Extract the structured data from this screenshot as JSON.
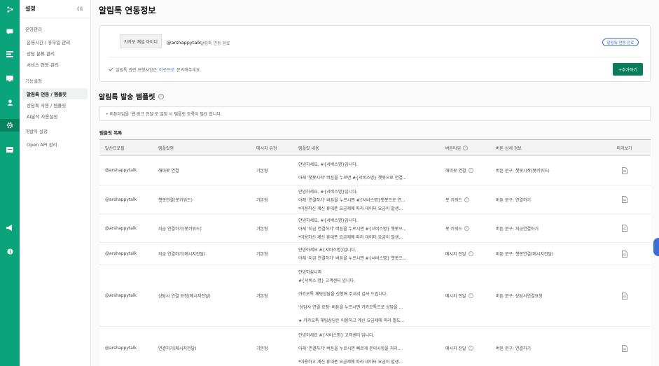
{
  "rail": {
    "icons": [
      "flow-icon",
      "chat-icon",
      "list-icon",
      "message-icon",
      "user-icon",
      "gear-icon",
      "card-icon",
      "megaphone-icon",
      "info-icon"
    ]
  },
  "sidebar": {
    "title": "설정",
    "groups": [
      {
        "label": "운영관리",
        "items": [
          "운영시간 / 휴무일 관리",
          "상담 분류 관리",
          "서비스 연동 관리"
        ]
      },
      {
        "label": "기능설정",
        "items": [
          "알림톡 연동 / 템플릿",
          "상담톡 사용 / 템플릿",
          "AI분석 사용설정"
        ]
      },
      {
        "label": "개발자 설정",
        "items": [
          "Open API 관리"
        ]
      }
    ]
  },
  "page": {
    "title": "알림톡 연동정보"
  },
  "channel": {
    "chip": "카카오 채널 아이디",
    "id": "@arshappytalk",
    "status": "알림톡 연동 완료",
    "pill": "알림톡 연동 완료",
    "notice_prefix": "알림톡 관련 요청사항은",
    "notice_link": "이곳으로",
    "notice_suffix": "문의해주세요.",
    "add_button": "+추가하기"
  },
  "templates": {
    "title": "알림톡 발송 템플릿",
    "help": "?",
    "info": "• 버튼타입을 '웹 링크 전달'로 설정 시 템플릿 등록이 필요 합니다.",
    "list_label": "템플릿 목록",
    "columns": [
      "발신프로필",
      "템플릿명",
      "메시지 유형",
      "템플릿 내용",
      "버튼타입",
      "버튼 상세 정보",
      "미리보기"
    ],
    "rows": [
      {
        "profile": "@arshappytalk",
        "name": "해피봇 연결",
        "type": "기본형",
        "content": [
          "안녕하세요. #{서비스명}입니다.",
          "",
          "아래 '챗봇시작' 버튼을 누르면 #{서비스명} 챗봇으로 연결..."
        ],
        "btn_type": "해피봇 연결",
        "btn_help": true,
        "btn_detail": "버튼 문구: 챗봇시작(봇키워드)"
      },
      {
        "profile": "@arshappytalk",
        "name": "챗봇연결(봇키워드)",
        "type": "기본형",
        "content": [
          "안녕하세요. #{서비스명}입니다.",
          "아래 '연결하기' 버튼을 누르시면 #{서비스명}챗봇으로 연...",
          "*이용하신 계신 휴대폰 요금제에 따라 데이터 요금이 발생..."
        ],
        "btn_type": "봇 키워드",
        "btn_help": true,
        "btn_detail": "버튼 문구: 연결하기"
      },
      {
        "profile": "@arshappytalk",
        "name": "지금 연결하기(봇키워드)",
        "type": "기본형",
        "content": [
          "안녕하세요. #{서비스명}입니다.",
          "아래 '지금 연결하기' 버튼을 누르시면 #{서비스명} 챗봇으...",
          "*이용하신 계신 휴대폰 요금제에 따라 데이터 요금이 발생..."
        ],
        "btn_type": "봇 키워드",
        "btn_help": true,
        "btn_detail": "버튼 문구: 지금연결하기"
      },
      {
        "profile": "@arshappytalk",
        "name": "지금 연결하기(메시지전달)",
        "type": "기본형",
        "content": [
          "안녕하세요 #{서비스명}입니다.",
          "아래 '지금 연결하기' 버튼을 누르시면 #{서비스명} 챗봇으..."
        ],
        "btn_type": "메시지 전달",
        "btn_help": true,
        "btn_detail": "버튼 문구: 챗봇연결(메시지전달)"
      },
      {
        "profile": "@arshappytalk",
        "name": "상담사 연결 요청(메시지전달)",
        "type": "기본형",
        "content": [
          "안녕하십니까",
          "#{서비스 명} 고객센터 입니다.",
          "",
          "카카오톡 채팅상담을 신청해 주셔서 감사 드립니다.",
          "",
          "'상담사 연결 요청' 버튼을 누르시면 카카오톡으로 상담을 ...",
          "",
          "★ 카카오톡 채팅상담은 이용하고 계신 요금제에 따라 별도..."
        ],
        "btn_type": "메시지 전달",
        "btn_help": true,
        "btn_detail": "버튼 문구: 상담사연결요청"
      },
      {
        "profile": "@arshappytalk",
        "name": "연결하기(메시지전달)",
        "type": "기본형",
        "content": [
          "안녕하세요 #{서비스명} 고객센터 입니다.",
          "",
          "아래 '연결하기' 버튼을 누르시면 빠르게 문의사항을 처리...",
          "",
          "*이용하고 계신 휴대폰 요금제에 따라 데이터 요금이 발생..."
        ],
        "btn_type": "메시지 전달",
        "btn_help": true,
        "btn_detail": "버튼 문구: 연결하기"
      }
    ]
  }
}
